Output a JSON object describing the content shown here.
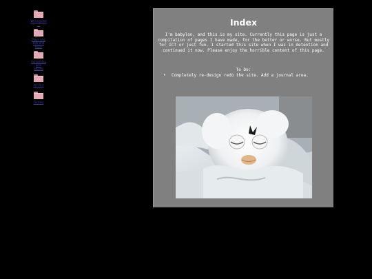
{
  "sidebar": {
    "items": [
      {
        "icon": "folder-icon",
        "label_lines": [
          "Writing and",
          "..."
        ]
      },
      {
        "icon": "folder-icon",
        "label_lines": [
          "Plays and",
          "Bits and",
          "Bobs"
        ]
      },
      {
        "icon": "folder-icon",
        "label_lines": [
          "Something",
          "Else",
          "Stories"
        ]
      },
      {
        "icon": "folder-icon",
        "label_lines": [
          "Art Pics"
        ]
      },
      {
        "icon": "folder-icon",
        "label_lines": [
          "Furbies"
        ]
      }
    ]
  },
  "main": {
    "title": "Index",
    "intro": "I'm babylon, and this is my site. Currently this page is just a compilation of pages I have made, for the better or worse. But mostly for ICT or just fun. I started this site when I was in detention and continued it now. Please enjoy the horrible content of this page.",
    "todo_heading": "To Do:",
    "todo_items": [
      "Completely re-design redo the site. Add a journal area."
    ],
    "bullet": "•",
    "image": {
      "subject": "white furby photo"
    }
  },
  "colors": {
    "background": "#000000",
    "panel": "#808080",
    "text": "#ffffff",
    "link": "#3f3f9a",
    "folder": "#e4a9b6"
  }
}
